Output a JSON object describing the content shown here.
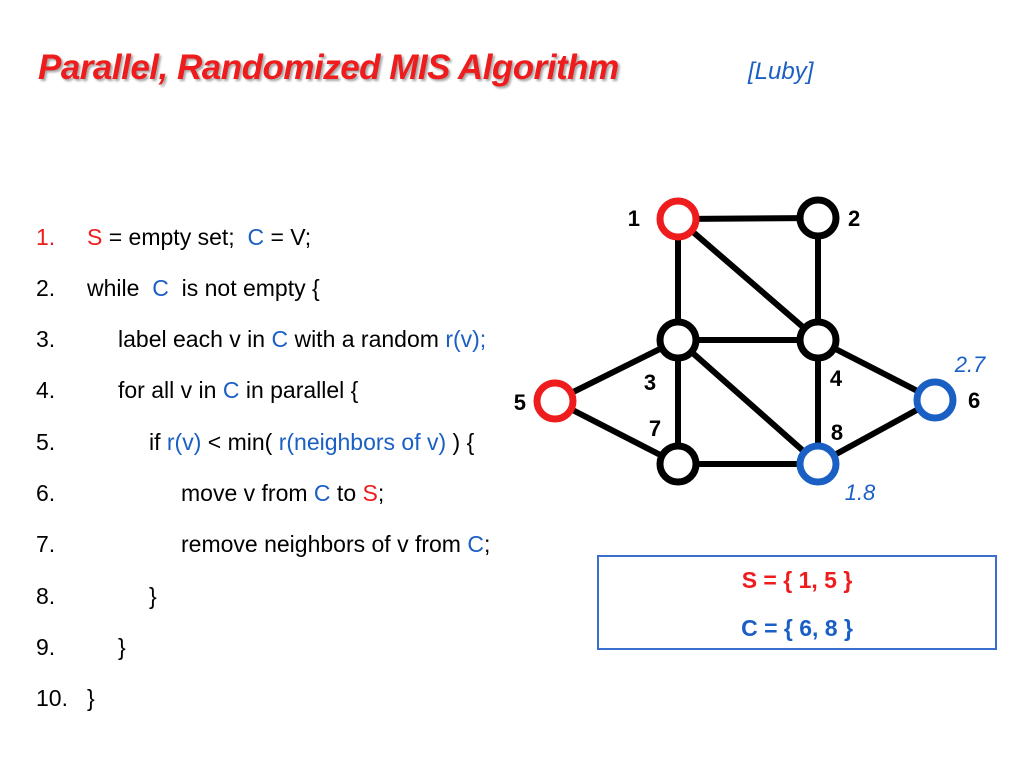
{
  "slide": {
    "title": "Parallel, Randomized MIS Algorithm",
    "citation": "[Luby]"
  },
  "algorithm": {
    "lines": [
      {
        "num": "1.",
        "parts": [
          {
            "t": "S",
            "c": "red"
          },
          {
            "t": " = empty set;  ",
            "c": ""
          },
          {
            "t": "C",
            "c": "blue"
          },
          {
            "t": " = V;",
            "c": ""
          }
        ]
      },
      {
        "num": "2.",
        "parts": [
          {
            "t": "while  ",
            "c": ""
          },
          {
            "t": "C",
            "c": "blue"
          },
          {
            "t": "  is not empty {",
            "c": ""
          }
        ]
      },
      {
        "num": "3.",
        "parts": [
          {
            "t": "label each v in ",
            "c": ""
          },
          {
            "t": "C",
            "c": "blue"
          },
          {
            "t": " with a random ",
            "c": ""
          },
          {
            "t": "r(v);",
            "c": "blue"
          }
        ]
      },
      {
        "num": "4.",
        "parts": [
          {
            "t": "for all v in ",
            "c": ""
          },
          {
            "t": "C",
            "c": "blue"
          },
          {
            "t": " in parallel {",
            "c": ""
          }
        ]
      },
      {
        "num": "5.",
        "parts": [
          {
            "t": "if ",
            "c": ""
          },
          {
            "t": "r(v)",
            "c": "blue"
          },
          {
            "t": " < min( ",
            "c": ""
          },
          {
            "t": "r(neighbors of v)",
            "c": "blue"
          },
          {
            "t": " ) {",
            "c": ""
          }
        ]
      },
      {
        "num": "6.",
        "parts": [
          {
            "t": "move v from ",
            "c": ""
          },
          {
            "t": "C",
            "c": "blue"
          },
          {
            "t": " to ",
            "c": ""
          },
          {
            "t": "S",
            "c": "red"
          },
          {
            "t": ";",
            "c": ""
          }
        ]
      },
      {
        "num": "7.",
        "parts": [
          {
            "t": "remove neighbors of v from ",
            "c": ""
          },
          {
            "t": "C",
            "c": "blue"
          },
          {
            "t": ";",
            "c": ""
          }
        ]
      },
      {
        "num": "8.",
        "parts": [
          {
            "t": "}",
            "c": ""
          }
        ]
      },
      {
        "num": "9.",
        "parts": [
          {
            "t": "}",
            "c": ""
          }
        ]
      },
      {
        "num": "10.",
        "parts": [
          {
            "t": "}",
            "c": ""
          }
        ]
      }
    ],
    "first_num_color": "red"
  },
  "graph": {
    "nodes": [
      {
        "id": "1",
        "state": "in-S"
      },
      {
        "id": "2",
        "state": "removed"
      },
      {
        "id": "3",
        "state": "removed"
      },
      {
        "id": "4",
        "state": "removed"
      },
      {
        "id": "5",
        "state": "in-S"
      },
      {
        "id": "6",
        "state": "in-C",
        "r": "2.7"
      },
      {
        "id": "7",
        "state": "removed"
      },
      {
        "id": "8",
        "state": "in-C",
        "r": "1.8"
      }
    ],
    "edges": [
      [
        "1",
        "2"
      ],
      [
        "1",
        "3"
      ],
      [
        "1",
        "4"
      ],
      [
        "2",
        "4"
      ],
      [
        "3",
        "4"
      ],
      [
        "3",
        "5"
      ],
      [
        "3",
        "7"
      ],
      [
        "3",
        "8"
      ],
      [
        "4",
        "8"
      ],
      [
        "4",
        "6"
      ],
      [
        "5",
        "7"
      ],
      [
        "7",
        "8"
      ],
      [
        "8",
        "6"
      ]
    ],
    "colors": {
      "in-S": "#ee1c1c",
      "in-C": "#1a5fc4",
      "removed": "#000000"
    }
  },
  "sets": {
    "S": "S = { 1, 5 }",
    "C": "C = { 6, 8 }",
    "S_color": "#ee1c1c",
    "C_color": "#1a5fc4"
  }
}
